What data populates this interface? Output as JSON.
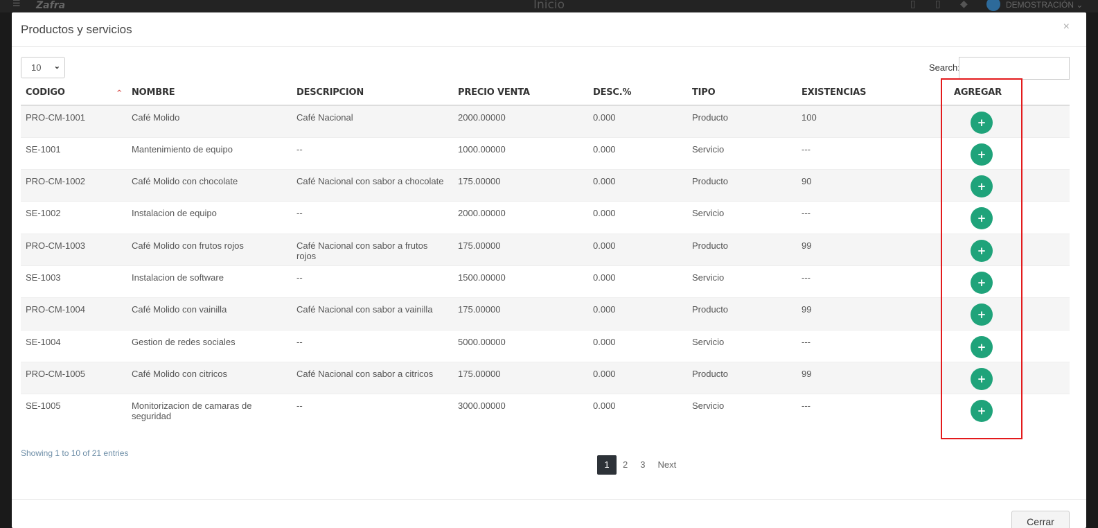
{
  "background": {
    "logo": "Zafra",
    "page_name": "Inicio",
    "user_name": "DEMOSTRACIÓN"
  },
  "modal": {
    "title": "Productos y servicios",
    "close_symbol": "×",
    "page_length": "10",
    "search_label": "Search:",
    "search_value": "",
    "columns": [
      "CODIGO",
      "NOMBRE",
      "DESCRIPCION",
      "PRECIO VENTA",
      "DESC.%",
      "TIPO",
      "EXISTENCIAS",
      "AGREGAR"
    ],
    "rows": [
      {
        "codigo": "PRO-CM-1001",
        "nombre": "Café Molido",
        "descripcion": "Café Nacional",
        "precio": "2000.00000",
        "desc": "0.000",
        "tipo": "Producto",
        "existencias": "100"
      },
      {
        "codigo": "SE-1001",
        "nombre": "Mantenimiento de equipo",
        "descripcion": "--",
        "precio": "1000.00000",
        "desc": "0.000",
        "tipo": "Servicio",
        "existencias": "---"
      },
      {
        "codigo": "PRO-CM-1002",
        "nombre": "Café Molido con chocolate",
        "descripcion": "Café Nacional con sabor a chocolate",
        "precio": "175.00000",
        "desc": "0.000",
        "tipo": "Producto",
        "existencias": "90"
      },
      {
        "codigo": "SE-1002",
        "nombre": "Instalacion de equipo",
        "descripcion": "--",
        "precio": "2000.00000",
        "desc": "0.000",
        "tipo": "Servicio",
        "existencias": "---"
      },
      {
        "codigo": "PRO-CM-1003",
        "nombre": "Café Molido con frutos rojos",
        "descripcion": "Café Nacional con sabor a frutos rojos",
        "precio": "175.00000",
        "desc": "0.000",
        "tipo": "Producto",
        "existencias": "99"
      },
      {
        "codigo": "SE-1003",
        "nombre": "Instalacion de software",
        "descripcion": "--",
        "precio": "1500.00000",
        "desc": "0.000",
        "tipo": "Servicio",
        "existencias": "---"
      },
      {
        "codigo": "PRO-CM-1004",
        "nombre": "Café Molido con vainilla",
        "descripcion": "Café Nacional con sabor a vainilla",
        "precio": "175.00000",
        "desc": "0.000",
        "tipo": "Producto",
        "existencias": "99"
      },
      {
        "codigo": "SE-1004",
        "nombre": "Gestion de redes sociales",
        "descripcion": "--",
        "precio": "5000.00000",
        "desc": "0.000",
        "tipo": "Servicio",
        "existencias": "---"
      },
      {
        "codigo": "PRO-CM-1005",
        "nombre": "Café Molido con citricos",
        "descripcion": "Café Nacional con sabor a citricos",
        "precio": "175.00000",
        "desc": "0.000",
        "tipo": "Producto",
        "existencias": "99"
      },
      {
        "codigo": "SE-1005",
        "nombre": "Monitorizacion de camaras de seguridad",
        "descripcion": "--",
        "precio": "3000.00000",
        "desc": "0.000",
        "tipo": "Servicio",
        "existencias": "---"
      }
    ],
    "add_symbol": "+",
    "info": "Showing 1 to 10 of 21 entries",
    "pages": [
      "1",
      "2",
      "3"
    ],
    "next_label": "Next",
    "footer_close": "Cerrar"
  },
  "colors": {
    "add_button": "#1fa37a",
    "highlight": "#e31a1c",
    "active_page": "#2d3238"
  }
}
